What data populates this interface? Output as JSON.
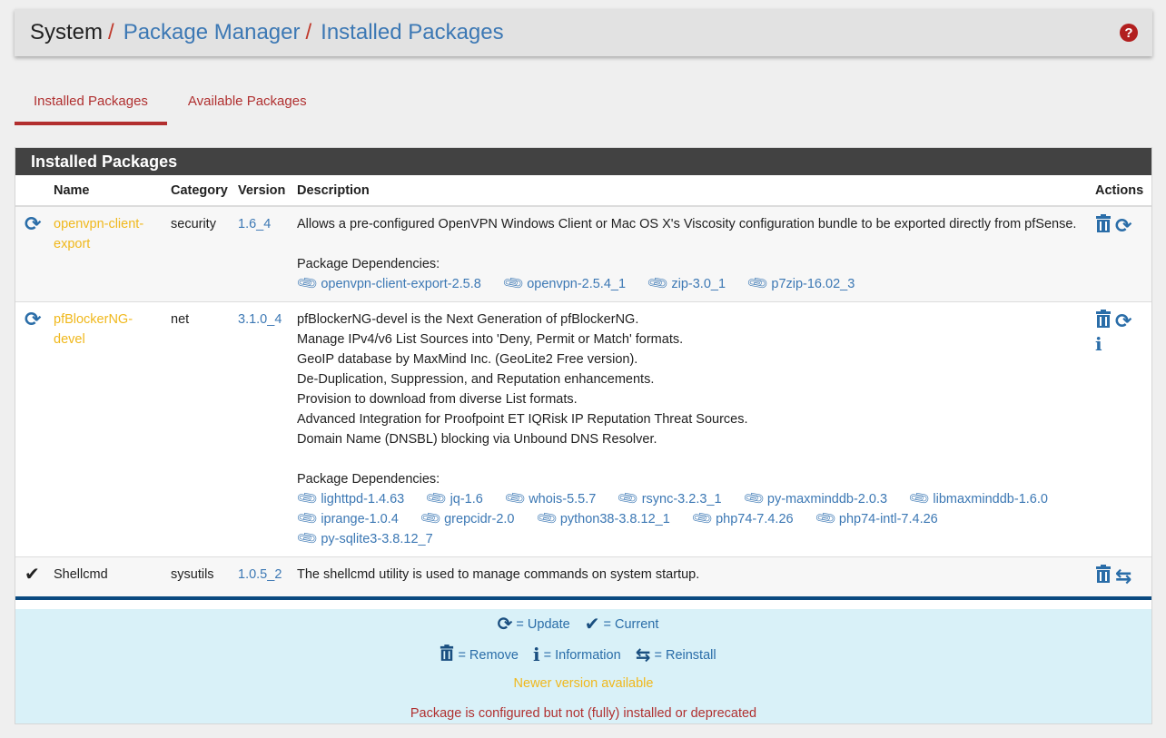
{
  "breadcrumb": {
    "items": [
      "System",
      "Package Manager",
      "Installed Packages"
    ],
    "separator": "/"
  },
  "help_icon": "question-circle-icon",
  "tabs": [
    {
      "label": "Installed Packages",
      "active": true
    },
    {
      "label": "Available Packages",
      "active": false
    }
  ],
  "panel": {
    "title": "Installed Packages",
    "columns": [
      "Name",
      "Category",
      "Version",
      "Description",
      "Actions"
    ]
  },
  "packages": [
    {
      "status_icon": "refresh-icon",
      "name": "openvpn-client-export",
      "category": "security",
      "version": "1.6_4",
      "description": [
        "Allows a pre-configured OpenVPN Windows Client or Mac OS X's Viscosity configuration bundle to be exported directly from pfSense."
      ],
      "deps_label": "Package Dependencies:",
      "deps": [
        "openvpn-client-export-2.5.8",
        "openvpn-2.5.4_1",
        "zip-3.0_1",
        "p7zip-16.02_3"
      ],
      "actions": [
        "trash-icon",
        "refresh-icon"
      ]
    },
    {
      "status_icon": "refresh-icon",
      "name": "pfBlockerNG-devel",
      "category": "net",
      "version": "3.1.0_4",
      "description": [
        "pfBlockerNG-devel is the Next Generation of pfBlockerNG.",
        "Manage IPv4/v6 List Sources into 'Deny, Permit or Match' formats.",
        "GeoIP database by MaxMind Inc. (GeoLite2 Free version).",
        "De-Duplication, Suppression, and Reputation enhancements.",
        "Provision to download from diverse List formats.",
        "Advanced Integration for Proofpoint ET IQRisk IP Reputation Threat Sources.",
        "Domain Name (DNSBL) blocking via Unbound DNS Resolver."
      ],
      "deps_label": "Package Dependencies:",
      "deps": [
        "lighttpd-1.4.63",
        "jq-1.6",
        "whois-5.5.7",
        "rsync-3.2.3_1",
        "py-maxminddb-2.0.3",
        "libmaxminddb-1.6.0",
        "iprange-1.0.4",
        "grepcidr-2.0",
        "python38-3.8.12_1",
        "php74-7.4.26",
        "php74-intl-7.4.26",
        "py-sqlite3-3.8.12_7"
      ],
      "actions": [
        "trash-icon",
        "refresh-icon",
        "info-icon"
      ]
    },
    {
      "status_icon": "check-icon",
      "name": "Shellcmd",
      "category": "sysutils",
      "version": "1.0.5_2",
      "description": [
        "The shellcmd utility is used to manage commands on system startup."
      ],
      "actions": [
        "trash-icon",
        "reinstall-icon"
      ]
    }
  ],
  "legend": {
    "update": "= Update",
    "current": "= Current",
    "remove": "= Remove",
    "information": "= Information",
    "reinstall": "= Reinstall",
    "newer": "Newer version available",
    "configured": "Package is configured but not (fully) installed or deprecated"
  },
  "colors": {
    "warn": "#f0b81c",
    "error": "#b03030",
    "link": "#3c78b4",
    "panel_heading": "#424242",
    "legend_bg": "#d9f1f8"
  }
}
